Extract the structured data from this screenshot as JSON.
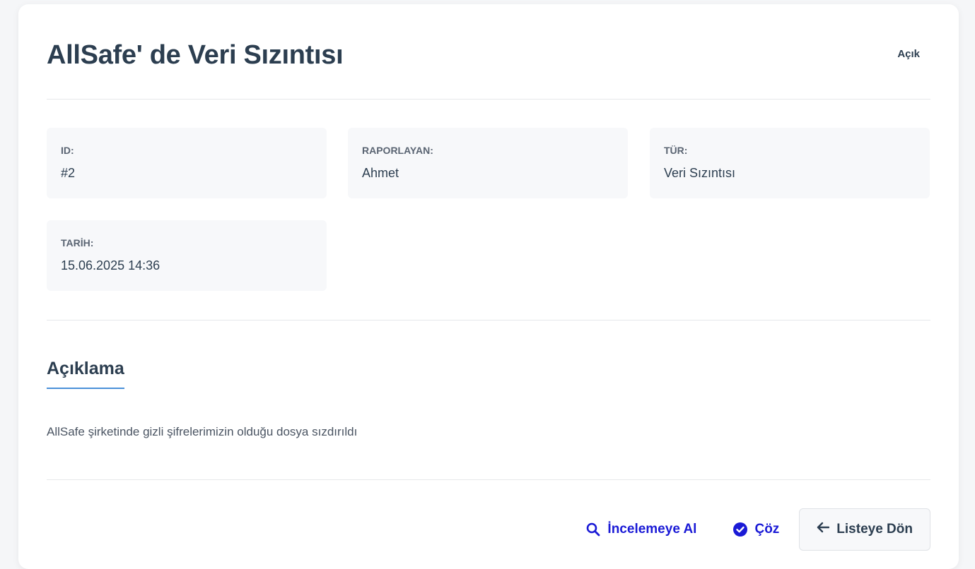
{
  "incident": {
    "title": "AllSafe' de Veri Sızıntısı",
    "status": "Açık"
  },
  "details": {
    "id": {
      "label": "ID:",
      "value": "#2"
    },
    "reporter": {
      "label": "RAPORLAYAN:",
      "value": "Ahmet"
    },
    "type": {
      "label": "TÜR:",
      "value": "Veri Sızıntısı"
    },
    "date": {
      "label": "TARİH:",
      "value": "15.06.2025 14:36"
    }
  },
  "description": {
    "heading": "Açıklama",
    "text": "AllSafe şirketinde gizli şifrelerimizin olduğu dosya sızdırıldı"
  },
  "actions": {
    "investigate_label": "İncelemeye Al",
    "investigate_icon": "search-icon",
    "resolve_label": "Çöz",
    "resolve_icon": "check-circle-icon",
    "back_label": "Listeye Dön",
    "back_icon": "arrow-left-icon"
  },
  "colors": {
    "accent": "#4a90d9",
    "link": "#1a1ad6",
    "text": "#2c3e50"
  }
}
